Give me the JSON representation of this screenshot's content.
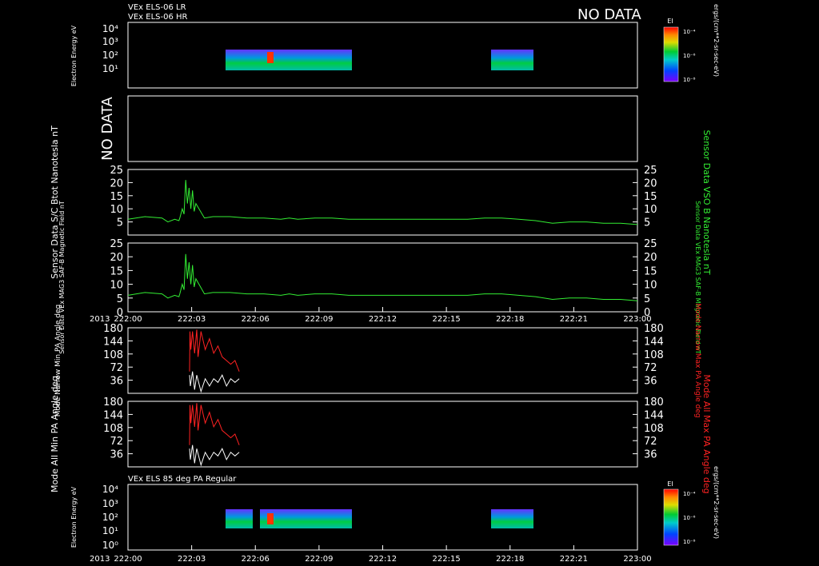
{
  "header": {
    "line1": "VEx ELS-06 LR",
    "line2": "VEx ELS-06 HR",
    "no_data": "NO DATA"
  },
  "panel2": {
    "label": "NO DATA"
  },
  "panel7": {
    "title": "VEx ELS 85 deg PA Regular"
  },
  "year_label": "2013",
  "colorbar": {
    "label": "EI",
    "ticks": [
      "10⁻⁴",
      "10⁻⁶",
      "10⁻⁸"
    ],
    "unit": "ergs/(cm**2-sr-sec-eV)"
  },
  "colors": {
    "background": "#000000",
    "axis": "#ffffff",
    "mag": "#33ee33",
    "max_pa": "#ff2222",
    "min_pa": "#ffffff"
  },
  "chart_data": [
    {
      "id": "els-lr-hr",
      "type": "heatmap",
      "ylabel": "Electron Energy\neV",
      "yticks": [
        "10⁴",
        "10³",
        "10²",
        "10¹"
      ],
      "y_scale": "log",
      "x_range": [
        "222:00",
        "223:00"
      ],
      "data_intervals": [
        [
          "222:04.7",
          "222:10.6"
        ],
        [
          "222:17.2",
          "222:19.0"
        ]
      ],
      "legend_position": "right colorbar"
    },
    {
      "id": "no-data-panel",
      "type": "line",
      "ylabel": "NO DATA"
    },
    {
      "id": "sc-btot",
      "type": "line",
      "ylabel": "Sensor Data\nS/C Btot\nNanotesla\nnT",
      "ylabel_right": "Sensor Data\nVSO B\nNanotesla\nnT",
      "ylim": [
        0,
        25
      ],
      "yticks": [
        5,
        10,
        15,
        20,
        25
      ],
      "x_range_min": [
        0,
        60
      ],
      "series": [
        {
          "x": [
            0,
            2,
            4,
            4.7,
            5.5,
            6,
            6.1,
            6.4,
            6.6,
            6.8,
            7.0,
            7.2,
            7.4,
            7.6,
            7.8,
            8,
            9,
            10,
            12,
            14,
            16,
            18,
            19,
            20,
            22,
            24,
            26,
            28,
            30,
            32,
            34,
            36,
            38,
            40,
            42,
            44,
            46,
            48,
            50,
            52,
            54,
            56,
            58,
            60
          ],
          "y": [
            6,
            7,
            6.5,
            5,
            6,
            5.5,
            6.5,
            10,
            8,
            21,
            12,
            18,
            10,
            17,
            9,
            12,
            6.5,
            7,
            7,
            6.5,
            6.5,
            6,
            6.5,
            6,
            6.5,
            6.5,
            6,
            6,
            6,
            6,
            6,
            6,
            6,
            6,
            6.5,
            6.5,
            6,
            5.5,
            4.5,
            5,
            5,
            4.5,
            4.5,
            4
          ]
        }
      ]
    },
    {
      "id": "mag-field",
      "type": "line",
      "ylabel": "Sensor Data\nVEx MAG3 SAF-B\nMagnetic Field\nnT",
      "ylabel_right": "Sensor Data\nVEx MAG3 SAF-B\nMagnetic Field\nnT",
      "ylim": [
        0,
        25
      ],
      "yticks": [
        0,
        5,
        10,
        15,
        20,
        25
      ],
      "xticks": [
        "222:00",
        "222:03",
        "222:06",
        "222:09",
        "222:12",
        "222:15",
        "222:18",
        "222:21",
        "223:00"
      ]
    },
    {
      "id": "narrow-pa",
      "type": "line",
      "ylabel": "Mode\nNarrow Min PA\nAngle\ndeg",
      "ylabel_right": "Mode\nNarrow Max PA\nAngle\ndeg",
      "ylim": [
        0,
        180
      ],
      "yticks": [
        36,
        72,
        108,
        144,
        180
      ]
    },
    {
      "id": "all-pa",
      "type": "line",
      "ylabel": "Mode\nAll Min PA\nAngle\ndeg",
      "ylabel_right": "Mode\nAll Max PA\nAngle\ndeg",
      "ylim": [
        0,
        180
      ],
      "yticks": [
        36,
        72,
        108,
        144,
        180
      ]
    },
    {
      "id": "els-85deg",
      "type": "heatmap",
      "ylabel": "Electron Energy\neV",
      "yticks": [
        "10⁴",
        "10³",
        "10²",
        "10¹",
        "10⁰"
      ],
      "y_scale": "log",
      "xticks": [
        "222:00",
        "222:03",
        "222:06",
        "222:09",
        "222:12",
        "222:15",
        "222:18",
        "222:21",
        "223:00"
      ],
      "data_intervals": [
        [
          "222:04.7",
          "222:05.9"
        ],
        [
          "222:06.2",
          "222:10.6"
        ],
        [
          "222:17.2",
          "222:19.0"
        ]
      ]
    }
  ]
}
